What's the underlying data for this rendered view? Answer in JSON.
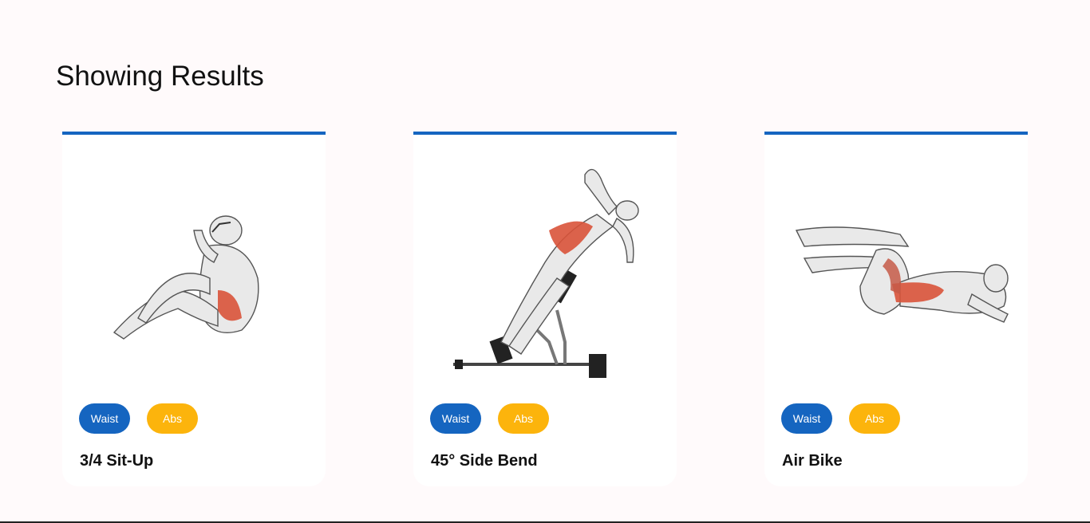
{
  "heading": "Showing Results",
  "colors": {
    "accent_blue": "#1565c0",
    "accent_yellow": "#fcb40c",
    "muscle_red": "#d9533a"
  },
  "cards": [
    {
      "title": "3/4 Sit-Up",
      "image_alt": "3/4 Sit-Up",
      "tags": [
        "Waist",
        "Abs"
      ]
    },
    {
      "title": "45° Side Bend",
      "image_alt": "45° Side Bend",
      "tags": [
        "Waist",
        "Abs"
      ]
    },
    {
      "title": "Air Bike",
      "image_alt": "Air Bike",
      "tags": [
        "Waist",
        "Abs"
      ]
    }
  ]
}
